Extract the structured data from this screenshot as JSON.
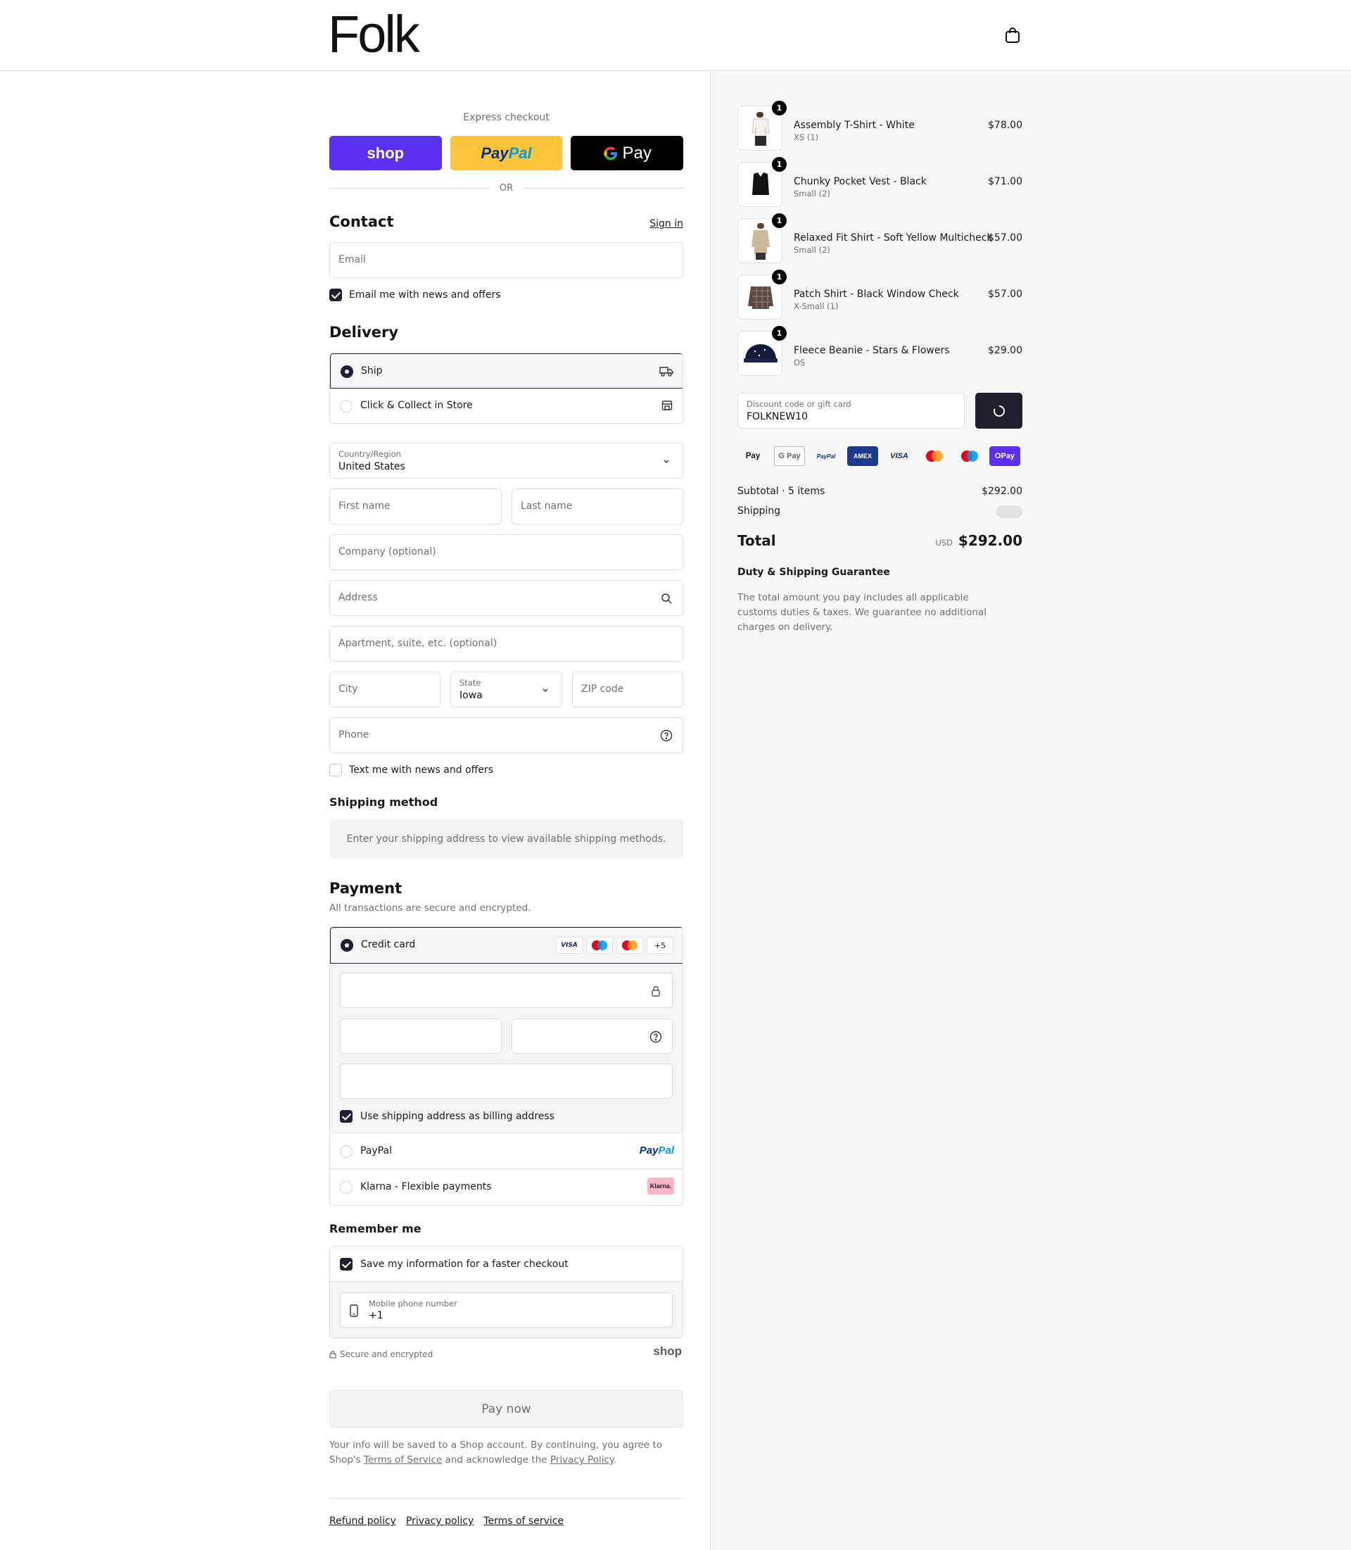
{
  "header": {
    "logo": "Folk",
    "cart_icon": "shopping-bag-icon"
  },
  "express": {
    "label": "Express checkout",
    "shop_label": "shop",
    "paypal_label_1": "Pay",
    "paypal_label_2": "Pal",
    "gpay_label": "Pay",
    "or_label": "OR"
  },
  "contact": {
    "title": "Contact",
    "signin": "Sign in",
    "email_placeholder": "Email",
    "news_checkbox": "Email me with news and offers"
  },
  "delivery": {
    "title": "Delivery",
    "options": [
      {
        "label": "Ship",
        "icon": "truck-icon",
        "selected": true
      },
      {
        "label": "Click & Collect in Store",
        "icon": "store-icon",
        "selected": false
      }
    ],
    "country_label": "Country/Region",
    "country_value": "United States",
    "first_name": "First name",
    "last_name": "Last name",
    "company": "Company (optional)",
    "address": "Address",
    "apartment": "Apartment, suite, etc. (optional)",
    "city": "City",
    "state_label": "State",
    "state_value": "Iowa",
    "zip": "ZIP code",
    "phone": "Phone",
    "text_checkbox": "Text me with news and offers"
  },
  "shipping_method": {
    "title": "Shipping method",
    "notice": "Enter your shipping address to view available shipping methods."
  },
  "payment": {
    "title": "Payment",
    "subtitle": "All transactions are secure and encrypted.",
    "credit_card_label": "Credit card",
    "card_more": "+5",
    "billing_checkbox": "Use shipping address as billing address",
    "paypal_label": "PayPal",
    "klarna_label": "Klarna - Flexible payments",
    "klarna_badge": "Klarna."
  },
  "remember": {
    "title": "Remember me",
    "save_checkbox": "Save my information for a faster checkout",
    "mobile_label": "Mobile phone number",
    "mobile_value": "+1",
    "secure_text": "Secure and encrypted",
    "shop_brand": "shop"
  },
  "pay_now": "Pay now",
  "legal": {
    "line1": "Your info will be saved to a Shop account. By continuing, you agree to Shop's",
    "terms": "Terms of Service",
    "middle": "and acknowledge the",
    "privacy": "Privacy Policy",
    "end": "."
  },
  "footer": {
    "links": [
      "Refund policy",
      "Privacy policy",
      "Terms of service"
    ]
  },
  "cart": {
    "items": [
      {
        "name": "Assembly T-Shirt - White",
        "variant": "XS (1)",
        "price": "$78.00",
        "qty": "1"
      },
      {
        "name": "Chunky Pocket Vest - Black",
        "variant": "Small (2)",
        "price": "$71.00",
        "qty": "1"
      },
      {
        "name": "Relaxed Fit Shirt - Soft Yellow Multicheck",
        "variant": "Small (2)",
        "price": "$57.00",
        "qty": "1"
      },
      {
        "name": "Patch Shirt - Black Window Check",
        "variant": "X-Small (1)",
        "price": "$57.00",
        "qty": "1"
      },
      {
        "name": "Fleece Beanie - Stars & Flowers",
        "variant": "OS",
        "price": "$29.00",
        "qty": "1"
      }
    ],
    "discount_label": "Discount code or gift card",
    "discount_value": "FOLKNEW10",
    "payment_icons": [
      "Pay",
      "G Pay",
      "PayPal",
      "AMEX",
      "VISA",
      "mastercard",
      "Maestro",
      "OPay"
    ],
    "subtotal_label": "Subtotal · 5 items",
    "subtotal_value": "$292.00",
    "shipping_label": "Shipping",
    "total_label": "Total",
    "currency": "USD",
    "total_value": "$292.00",
    "guarantee_title": "Duty & Shipping Guarantee",
    "guarantee_text": "The total amount you pay includes all applicable customs duties & taxes. We guarantee no additional charges on delivery."
  }
}
